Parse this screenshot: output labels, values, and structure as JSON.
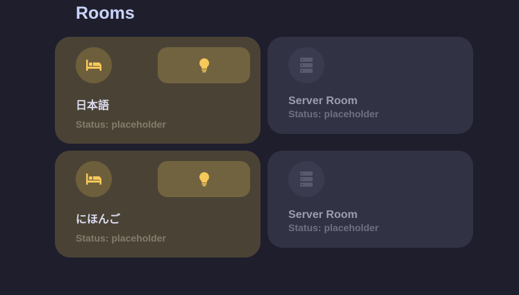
{
  "section": {
    "title": "Rooms"
  },
  "colors": {
    "accent_icon": "#f7c85a",
    "active_card": "#4a4335",
    "inactive_card": "#313244"
  },
  "rooms": [
    {
      "name": "日本語",
      "status": "Status: placeholder",
      "icon": "bed-icon",
      "action_icon": "lightbulb-icon",
      "active": true
    },
    {
      "name": "Server Room",
      "status": "Status: placeholder",
      "icon": "server-icon",
      "active": false
    },
    {
      "name": "にほんご",
      "status": "Status: placeholder",
      "icon": "bed-icon",
      "action_icon": "lightbulb-icon",
      "active": true
    },
    {
      "name": "Server Room",
      "status": "Status: placeholder",
      "icon": "server-icon",
      "active": false
    }
  ]
}
